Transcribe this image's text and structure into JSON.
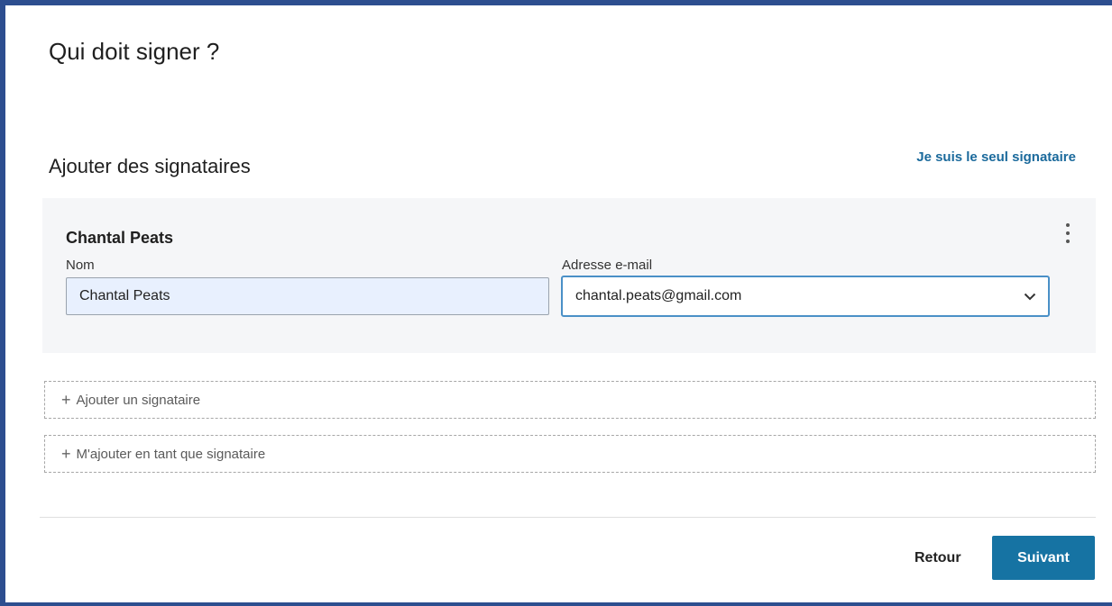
{
  "header": {
    "title": "Qui doit signer ?"
  },
  "signers_section": {
    "title": "Ajouter des signataires",
    "only_signer_link": "Je suis le seul signataire"
  },
  "signer_card": {
    "signer_name": "Chantal Peats",
    "name_label": "Nom",
    "name_value": "Chantal Peats",
    "email_label": "Adresse e-mail",
    "email_value": "chantal.peats@gmail.com",
    "more_options_icon": "vertical-ellipsis-icon",
    "dropdown_icon": "chevron-down-icon"
  },
  "actions": {
    "add_signer": {
      "icon": "plus-icon",
      "label": "Ajouter un signataire"
    },
    "add_me": {
      "icon": "plus-icon",
      "label": "M'ajouter en tant que signataire"
    }
  },
  "footer": {
    "back_label": "Retour",
    "next_label": "Suivant"
  },
  "colors": {
    "frame_border": "#2d4e8f",
    "link": "#1b6a9c",
    "primary_button": "#1673a3",
    "card_background": "#f5f6f8",
    "name_input_background": "#e8f0fe",
    "focused_border": "#4a90c7"
  }
}
